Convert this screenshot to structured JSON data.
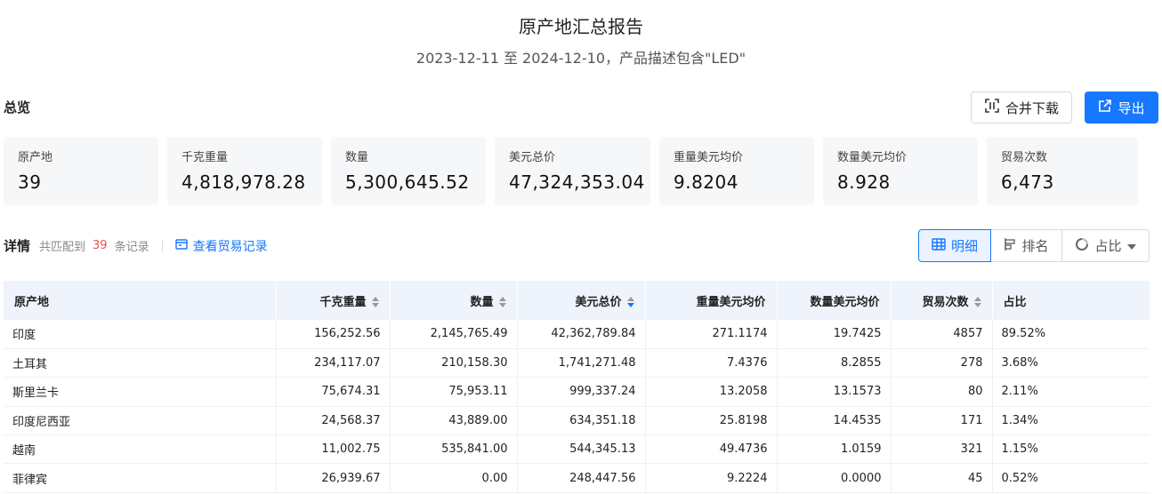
{
  "report": {
    "title": "原产地汇总报告",
    "subtitle": "2023-12-11 至 2024-12-10，产品描述包含\"LED\""
  },
  "overview": {
    "label": "总览",
    "merge_download_label": "合并下载",
    "export_label": "导出"
  },
  "stats": [
    {
      "label": "原产地",
      "value": "39"
    },
    {
      "label": "千克重量",
      "value": "4,818,978.28"
    },
    {
      "label": "数量",
      "value": "5,300,645.52"
    },
    {
      "label": "美元总价",
      "value": "47,324,353.04"
    },
    {
      "label": "重量美元均价",
      "value": "9.8204"
    },
    {
      "label": "数量美元均价",
      "value": "8.928"
    },
    {
      "label": "贸易次数",
      "value": "6,473"
    }
  ],
  "detail": {
    "label": "详情",
    "match_prefix": "共匹配到",
    "match_count": "39",
    "match_suffix": "条记录",
    "view_trade_label": "查看贸易记录"
  },
  "view_modes": {
    "detail": "明细",
    "ranking": "排名",
    "share": "占比"
  },
  "table": {
    "columns": [
      "原产地",
      "千克重量",
      "数量",
      "美元总价",
      "重量美元均价",
      "数量美元均价",
      "贸易次数",
      "占比"
    ],
    "rows": [
      [
        "印度",
        "156,252.56",
        "2,145,765.49",
        "42,362,789.84",
        "271.1174",
        "19.7425",
        "4857",
        "89.52%"
      ],
      [
        "土耳其",
        "234,117.07",
        "210,158.30",
        "1,741,271.48",
        "7.4376",
        "8.2855",
        "278",
        "3.68%"
      ],
      [
        "斯里兰卡",
        "75,674.31",
        "75,953.11",
        "999,337.24",
        "13.2058",
        "13.1573",
        "80",
        "2.11%"
      ],
      [
        "印度尼西亚",
        "24,568.37",
        "43,889.00",
        "634,351.18",
        "25.8198",
        "14.4535",
        "171",
        "1.34%"
      ],
      [
        "越南",
        "11,002.75",
        "535,841.00",
        "544,345.13",
        "49.4736",
        "1.0159",
        "321",
        "1.15%"
      ],
      [
        "菲律宾",
        "26,939.67",
        "0.00",
        "248,447.56",
        "9.2224",
        "0.0000",
        "45",
        "0.52%"
      ]
    ]
  },
  "colors": {
    "accent": "#1677ff",
    "count_highlight": "#e5534b",
    "header_bg": "#eff3fb",
    "card_bg": "#f6f7f9"
  }
}
